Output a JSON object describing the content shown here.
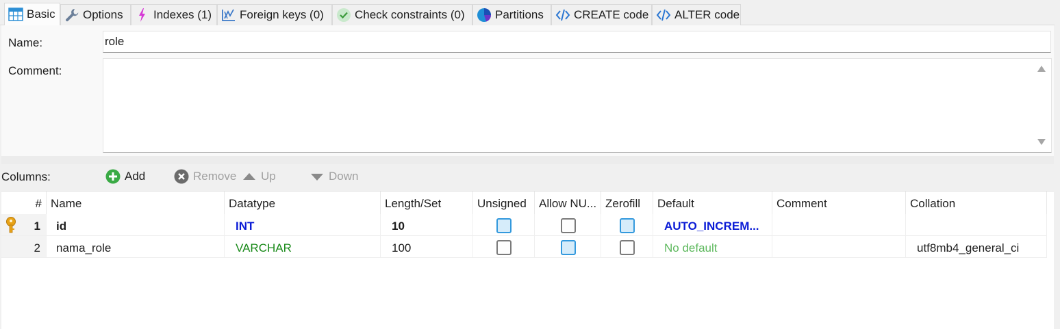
{
  "tabs": [
    {
      "label": "Basic",
      "icon": "table-icon",
      "active": true
    },
    {
      "label": "Options",
      "icon": "wrench-icon"
    },
    {
      "label": "Indexes (1)",
      "icon": "lightning-icon"
    },
    {
      "label": "Foreign keys (0)",
      "icon": "foreign-key-icon"
    },
    {
      "label": "Check constraints (0)",
      "icon": "check-circle-icon"
    },
    {
      "label": "Partitions",
      "icon": "pie-icon"
    },
    {
      "label": "CREATE code",
      "icon": "code-icon"
    },
    {
      "label": "ALTER code",
      "icon": "code-icon"
    }
  ],
  "form": {
    "name_label": "Name:",
    "name_value": "role",
    "comment_label": "Comment:",
    "comment_value": ""
  },
  "columns_toolbar": {
    "label": "Columns:",
    "add": "Add",
    "remove": "Remove",
    "up": "Up",
    "down": "Down"
  },
  "grid": {
    "headers": [
      "#",
      "Name",
      "Datatype",
      "Length/Set",
      "Unsigned",
      "Allow NU...",
      "Zerofill",
      "Default",
      "Comment",
      "Collation"
    ],
    "rows": [
      {
        "num": "1",
        "name": "id",
        "datatype": "INT",
        "length": "10",
        "unsigned": true,
        "allow_null": false,
        "zerofill": true,
        "default": "AUTO_INCREM...",
        "comment": "",
        "collation": "",
        "primary_key": true
      },
      {
        "num": "2",
        "name": "nama_role",
        "datatype": "VARCHAR",
        "length": "100",
        "unsigned": false,
        "allow_null": true,
        "zerofill": false,
        "default": "No default",
        "comment": "",
        "collation": "utf8mb4_general_ci",
        "primary_key": false
      }
    ]
  },
  "colors": {
    "int_type": "#0a1bd6",
    "varchar_type": "#1a8a1a",
    "auto_increment": "#0a1bd6",
    "no_default": "#5cb85c",
    "check_on": "#3399dd",
    "key": "#e8a317"
  }
}
